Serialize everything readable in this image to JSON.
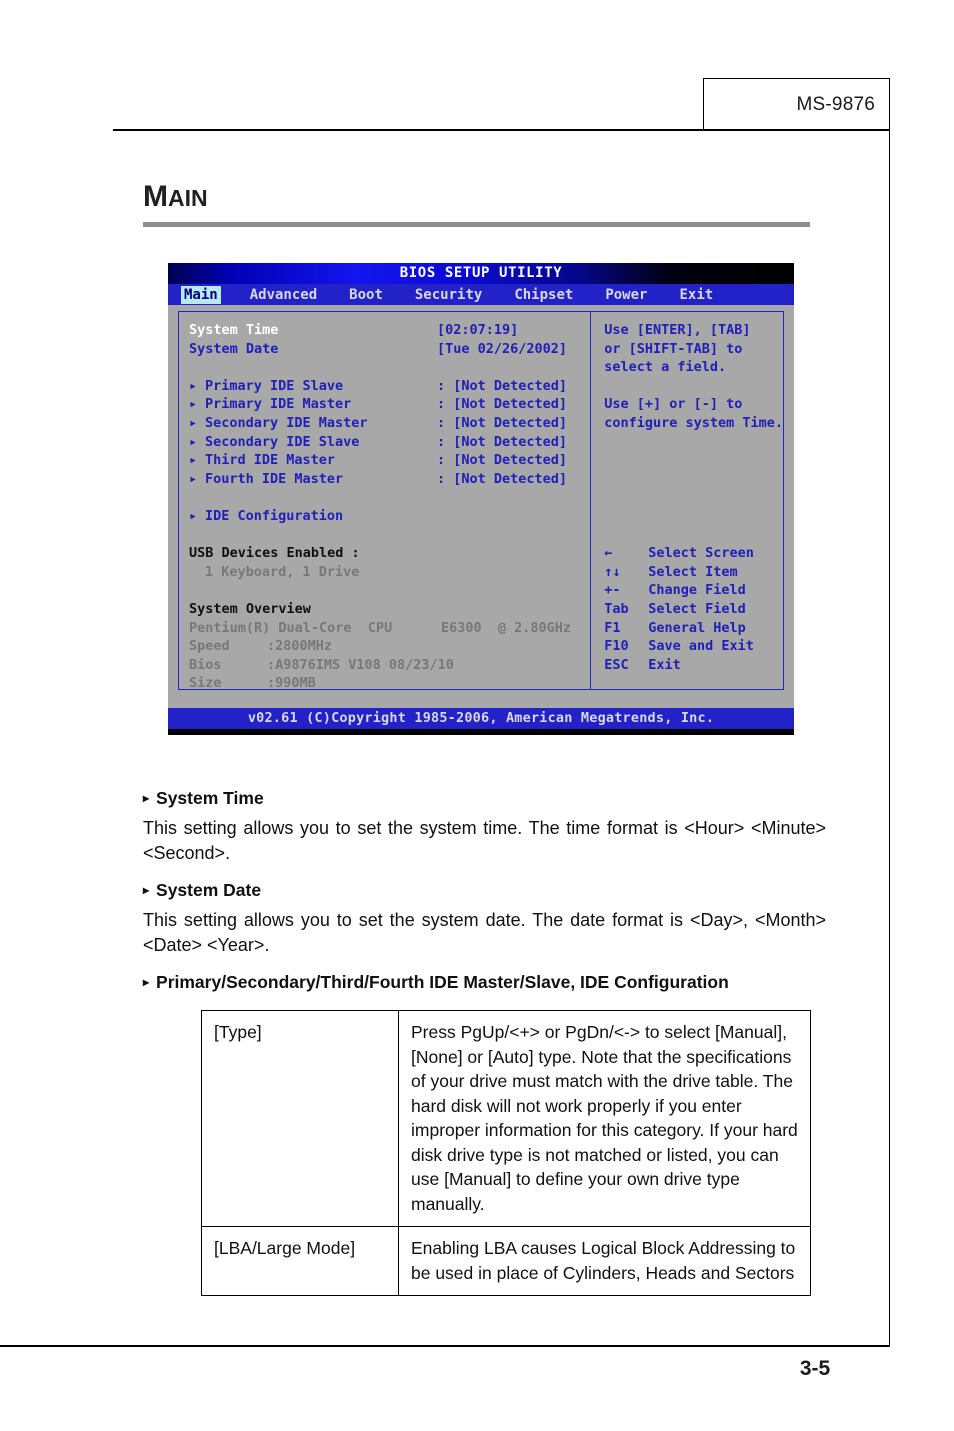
{
  "page": {
    "model": "MS-9876",
    "page_number": "3-5",
    "section_title_cap": "M",
    "section_title_rest": "AIN"
  },
  "bios": {
    "title": "BIOS SETUP UTILITY",
    "menu": [
      {
        "label": "Main",
        "selected": true
      },
      {
        "label": "Advanced",
        "selected": false
      },
      {
        "label": "Boot",
        "selected": false
      },
      {
        "label": "Security",
        "selected": false
      },
      {
        "label": "Chipset",
        "selected": false
      },
      {
        "label": "Power",
        "selected": false
      },
      {
        "label": "Exit",
        "selected": false
      }
    ],
    "settings": [
      {
        "label": "System Time",
        "value": "[02:07:19]",
        "style": "selected"
      },
      {
        "label": "System Date",
        "value": "[Tue 02/26/2002]",
        "style": "normal"
      }
    ],
    "ide_items": [
      {
        "label": "Primary IDE Slave",
        "value": ": [Not Detected]"
      },
      {
        "label": "Primary IDE Master",
        "value": ": [Not Detected]"
      },
      {
        "label": "Secondary IDE Master",
        "value": ": [Not Detected]"
      },
      {
        "label": "Secondary IDE Slave",
        "value": ": [Not Detected]"
      },
      {
        "label": "Third IDE Master",
        "value": ": [Not Detected]"
      },
      {
        "label": "Fourth IDE Master",
        "value": ": [Not Detected]"
      }
    ],
    "ide_configuration": "IDE Configuration",
    "usb": {
      "heading": "USB Devices Enabled :",
      "detail": "1 Keyboard, 1 Drive"
    },
    "overview": {
      "heading": "System Overview",
      "cpu": "Pentium(R) Dual-Core  CPU      E6300  @ 2.80GHz",
      "speed_label": "Speed",
      "speed_value": ":2800MHz",
      "bios_label": "Bios",
      "bios_value": ":A9876IMS V108 08/23/10",
      "size_label": "Size",
      "size_value": ":990MB"
    },
    "help": {
      "line1": "Use [ENTER], [TAB]",
      "line2": "or [SHIFT-TAB] to",
      "line3": "select a field.",
      "line4": "Use [+] or [-] to",
      "line5": "configure system Time."
    },
    "legend": [
      {
        "key": "←",
        "action": "Select Screen"
      },
      {
        "key": "↑↓",
        "action": "Select Item"
      },
      {
        "key": "+-",
        "action": "Change Field"
      },
      {
        "key": "Tab",
        "action": "Select Field"
      },
      {
        "key": "F1",
        "action": "General Help"
      },
      {
        "key": "F10",
        "action": "Save and Exit"
      },
      {
        "key": "ESC",
        "action": "Exit"
      }
    ],
    "footer": "v02.61 (C)Copyright 1985-2006, American Megatrends, Inc."
  },
  "content": {
    "system_time_heading": "System Time",
    "system_time_body": "This setting allows you to set the system time. The time format is <Hour> <Minute> <Second>.",
    "system_date_heading": "System Date",
    "system_date_body": "This setting allows you to set the system date. The date format is <Day>, <Month> <Date> <Year>.",
    "ide_heading": "Primary/Secondary/Third/Fourth IDE Master/Slave, IDE Configuration"
  },
  "table": {
    "rows": [
      {
        "key": "[Type]",
        "desc": "Press PgUp/<+> or PgDn/<-> to select [Manual], [None] or [Auto] type. Note that the specifications of your drive must match with the drive table. The hard disk will not work properly if you enter improper information for this category. If your hard disk drive type is not matched or listed, you can use [Manual] to define your own drive type manually."
      },
      {
        "key": "[LBA/Large Mode]",
        "desc": "Enabling LBA causes Logical Block Addressing to be used in place of Cylinders, Heads and Sectors"
      }
    ]
  },
  "colors": {
    "bios_blue": "#2222c8",
    "bios_gray": "#a8a8a8",
    "rule_gray": "#8d8d8d"
  }
}
